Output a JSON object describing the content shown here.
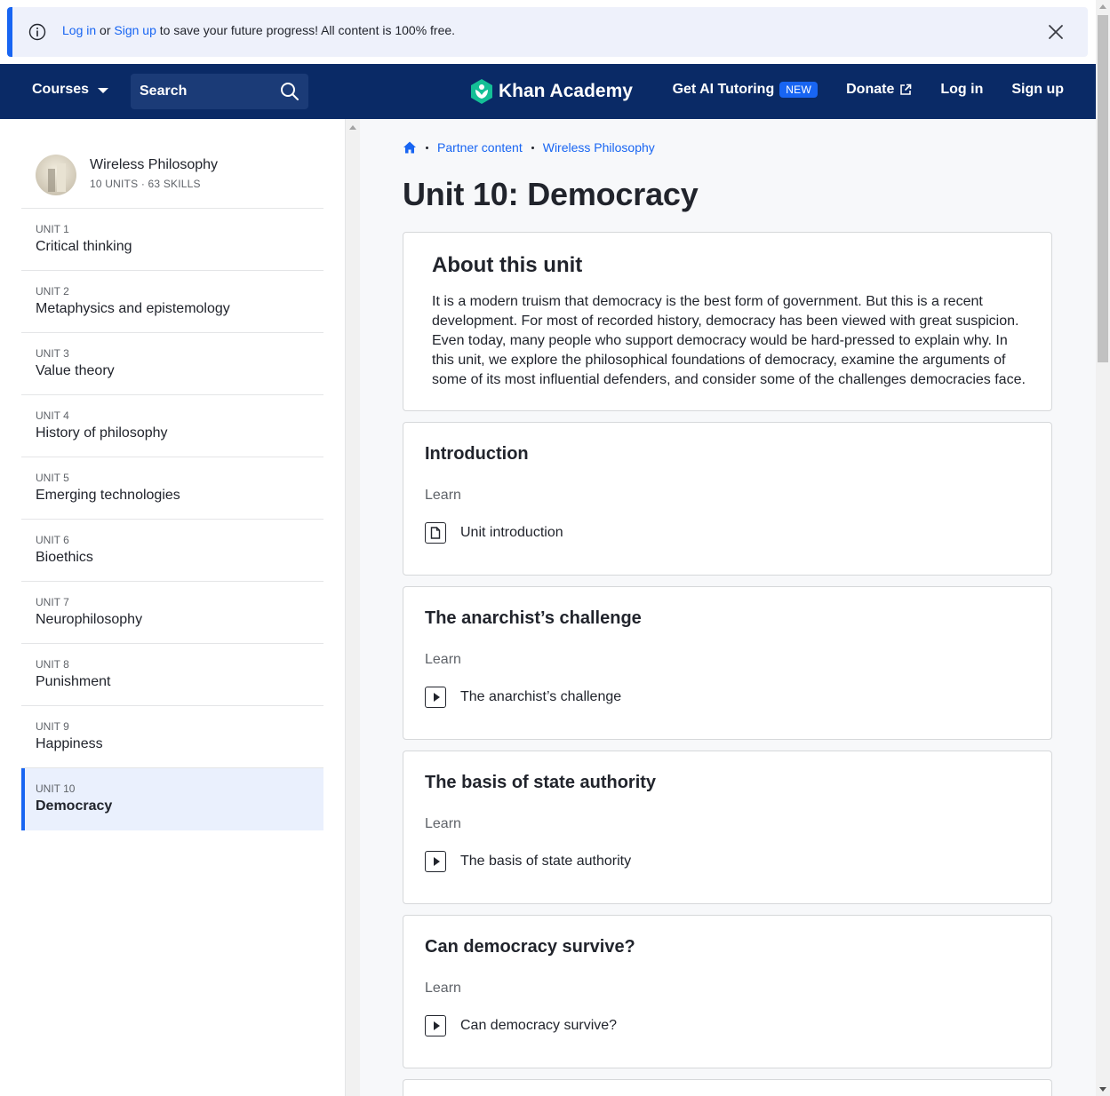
{
  "banner": {
    "login_link": "Log in",
    "or_text": "or",
    "signup_link": "Sign up",
    "message": "to save your future progress! All content is 100% free."
  },
  "header": {
    "courses_label": "Courses",
    "search_placeholder": "Search",
    "logo_text": "Khan Academy",
    "ai_tutoring_label": "Get AI Tutoring",
    "new_badge": "NEW",
    "donate_label": "Donate",
    "login_label": "Log in",
    "signup_label": "Sign up"
  },
  "sidebar": {
    "course_title": "Wireless Philosophy",
    "course_meta": "10 UNITS · 63 SKILLS",
    "units": [
      {
        "num": "UNIT 1",
        "name": "Critical thinking"
      },
      {
        "num": "UNIT 2",
        "name": "Metaphysics and epistemology"
      },
      {
        "num": "UNIT 3",
        "name": "Value theory"
      },
      {
        "num": "UNIT 4",
        "name": "History of philosophy"
      },
      {
        "num": "UNIT 5",
        "name": "Emerging technologies"
      },
      {
        "num": "UNIT 6",
        "name": "Bioethics"
      },
      {
        "num": "UNIT 7",
        "name": "Neurophilosophy"
      },
      {
        "num": "UNIT 8",
        "name": "Punishment"
      },
      {
        "num": "UNIT 9",
        "name": "Happiness"
      },
      {
        "num": "UNIT 10",
        "name": "Democracy"
      }
    ]
  },
  "breadcrumb": {
    "items": [
      "Partner content",
      "Wireless Philosophy"
    ]
  },
  "main": {
    "title": "Unit 10: Democracy",
    "about_heading": "About this unit",
    "about_text": "It is a modern truism that democracy is the best form of government. But this is a recent development. For most of recorded history, democracy has been viewed with great suspicion. Even today, many people who support democracy would be hard-pressed to explain why. In this unit, we explore the philosophical foundations of democracy, examine the arguments of some of its most influential defenders, and consider some of the challenges democracies face.",
    "lessons": [
      {
        "title": "Introduction",
        "section": "Learn",
        "item": "Unit introduction",
        "icon": "article-icon"
      },
      {
        "title": "The anarchist’s challenge",
        "section": "Learn",
        "item": "The anarchist’s challenge",
        "icon": "play-icon"
      },
      {
        "title": "The basis of state authority",
        "section": "Learn",
        "item": "The basis of state authority",
        "icon": "play-icon"
      },
      {
        "title": "Can democracy survive?",
        "section": "Learn",
        "item": "Can democracy survive?",
        "icon": "play-icon"
      }
    ]
  },
  "colors": {
    "header_bg": "#0a2a66",
    "accent": "#1865f2",
    "logo_green": "#14bf96",
    "active_unit_bg": "#eaf0fd"
  }
}
